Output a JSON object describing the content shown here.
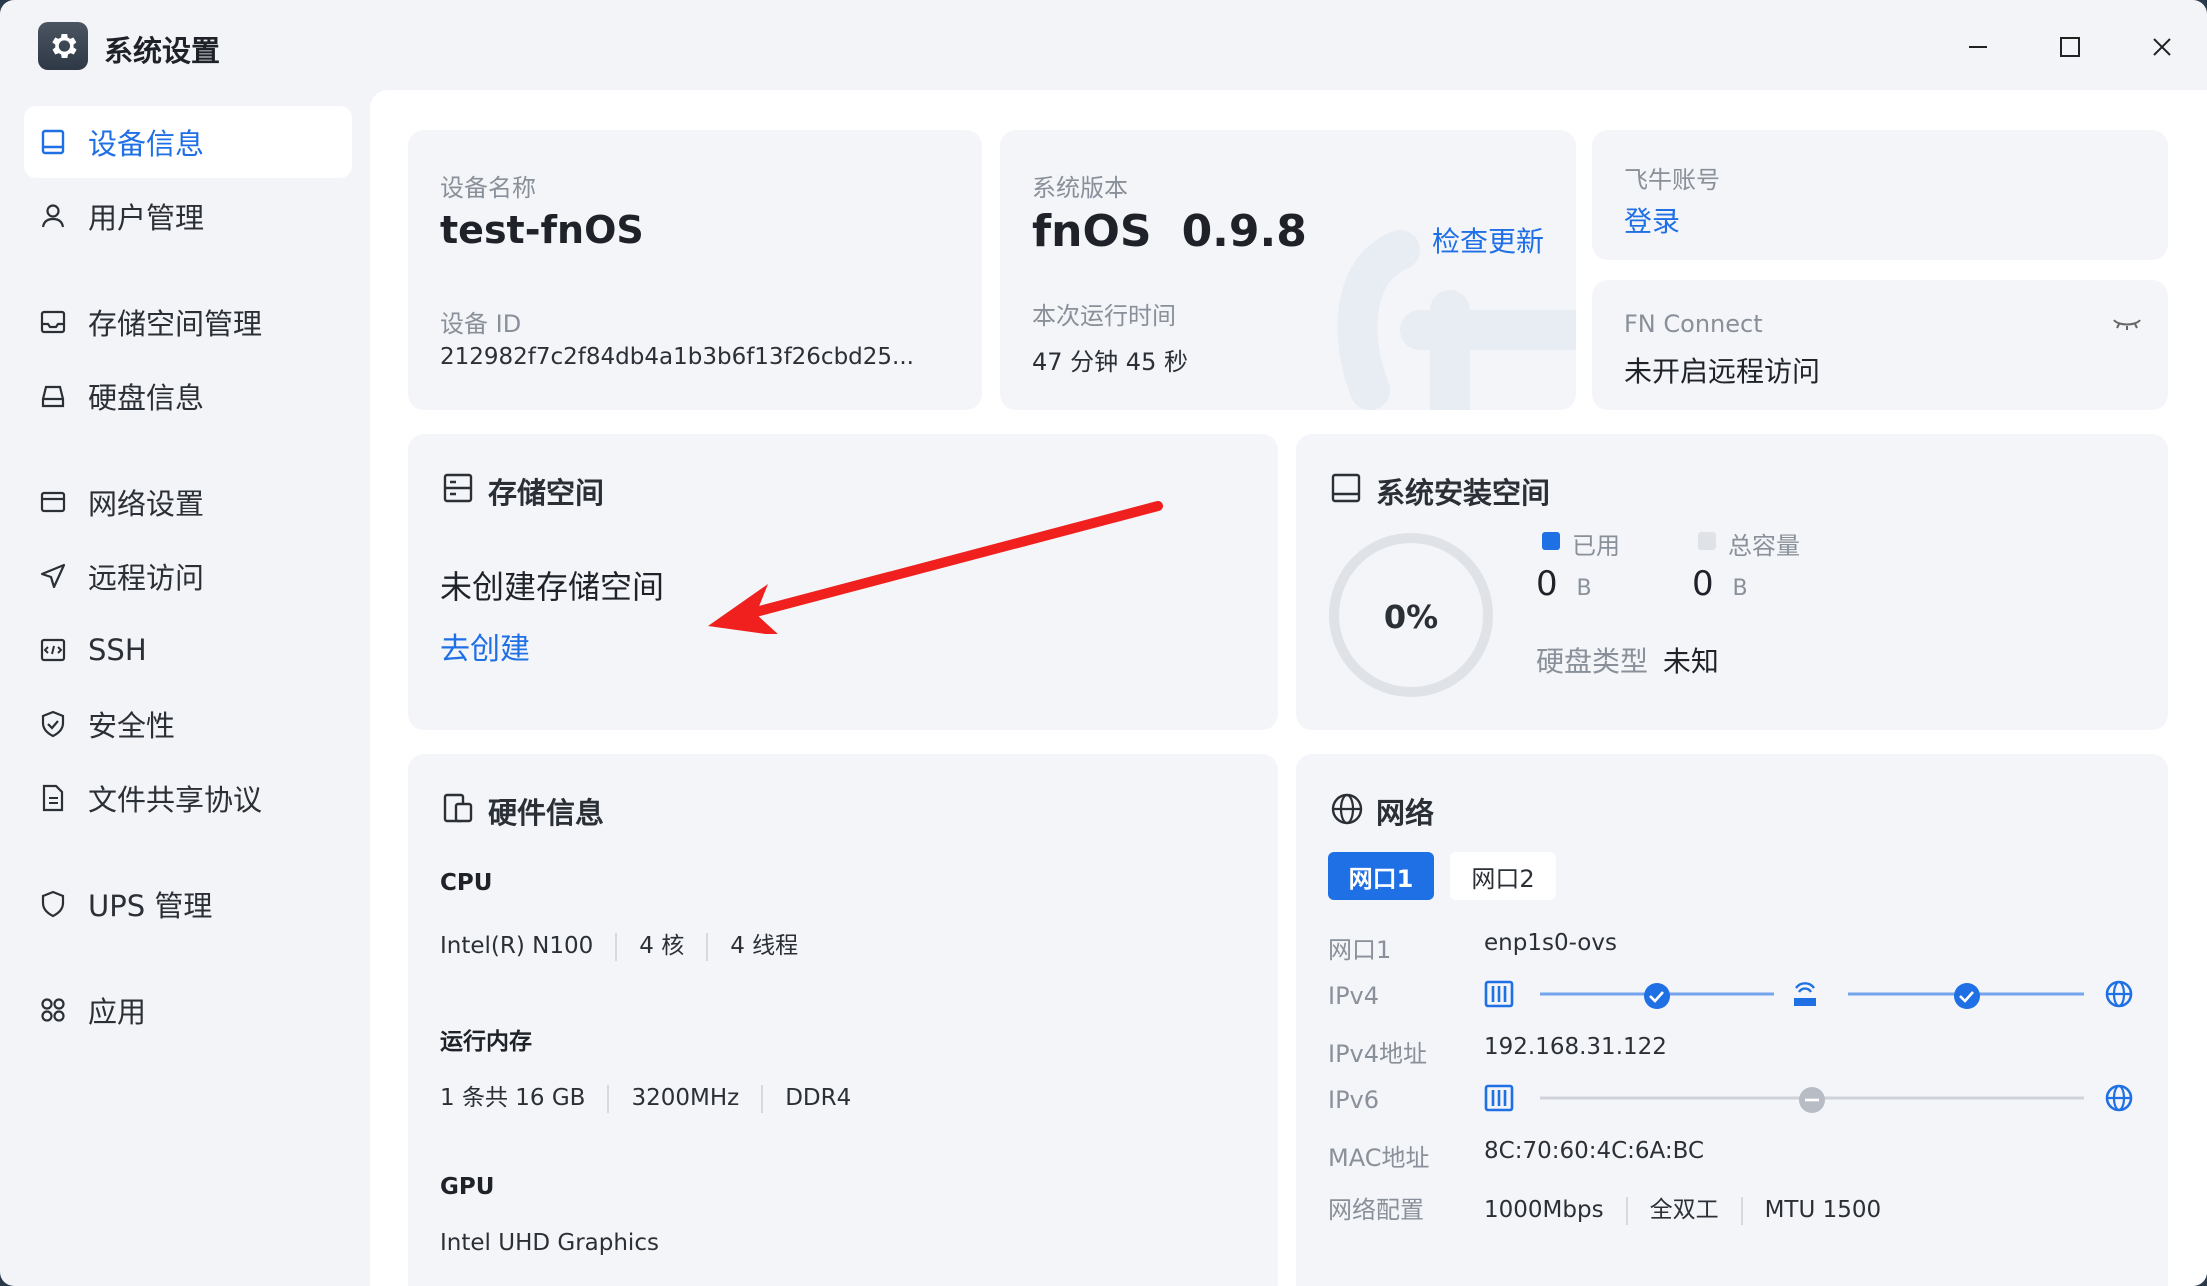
{
  "window": {
    "title": "系统设置"
  },
  "sidebar": {
    "items": [
      {
        "label": "设备信息",
        "icon": "monitor-icon",
        "active": true
      },
      {
        "label": "用户管理",
        "icon": "user-icon"
      },
      {
        "label": "存储空间管理",
        "icon": "storage-icon"
      },
      {
        "label": "硬盘信息",
        "icon": "disk-icon"
      },
      {
        "label": "网络设置",
        "icon": "network-icon"
      },
      {
        "label": "远程访问",
        "icon": "send-icon"
      },
      {
        "label": "SSH",
        "icon": "terminal-icon"
      },
      {
        "label": "安全性",
        "icon": "shield-check-icon"
      },
      {
        "label": "文件共享协议",
        "icon": "document-icon"
      },
      {
        "label": "UPS 管理",
        "icon": "shield-icon"
      },
      {
        "label": "应用",
        "icon": "apps-icon"
      }
    ]
  },
  "device": {
    "name_label": "设备名称",
    "name": "test-fnOS",
    "id_label": "设备 ID",
    "id_value": "212982f7c2f84db4a1b3b6f13f26cbd25..."
  },
  "system": {
    "version_label": "系统版本",
    "os": "fnOS",
    "version": "0.9.8",
    "check_update": "检查更新",
    "uptime_label": "本次运行时间",
    "uptime": "47 分钟 45 秒"
  },
  "account": {
    "label": "飞牛账号",
    "login": "登录"
  },
  "fn_connect": {
    "label": "FN Connect",
    "status": "未开启远程访问"
  },
  "storage": {
    "title": "存储空间",
    "empty": "未创建存储空间",
    "create": "去创建"
  },
  "install_space": {
    "title": "系统安装空间",
    "percent": "0%",
    "used_label": "已用",
    "used_value": "0",
    "used_unit": "B",
    "total_label": "总容量",
    "total_value": "0",
    "total_unit": "B",
    "disk_type_label": "硬盘类型",
    "disk_type": "未知"
  },
  "hardware": {
    "title": "硬件信息",
    "cpu_label": "CPU",
    "cpu_model": "Intel(R) N100",
    "cpu_cores": "4 核",
    "cpu_threads": "4 线程",
    "mem_label": "运行内存",
    "mem_size": "1 条共 16 GB",
    "mem_speed": "3200MHz",
    "mem_type": "DDR4",
    "gpu_label": "GPU",
    "gpu_model": "Intel UHD Graphics"
  },
  "network": {
    "title": "网络",
    "tabs": [
      "网口1",
      "网口2"
    ],
    "rows": {
      "port_label": "网口1",
      "port_value": "enp1s0-ovs",
      "ipv4_label": "IPv4",
      "ipv4_addr_label": "IPv4地址",
      "ipv4_addr": "192.168.31.122",
      "ipv6_label": "IPv6",
      "mac_label": "MAC地址",
      "mac": "8C:70:60:4C:6A:BC",
      "config_label": "网络配置",
      "speed": "1000Mbps",
      "duplex": "全双工",
      "mtu": "MTU 1500"
    }
  },
  "colors": {
    "accent": "#1f6fe5",
    "arrow": "#f0201e"
  }
}
